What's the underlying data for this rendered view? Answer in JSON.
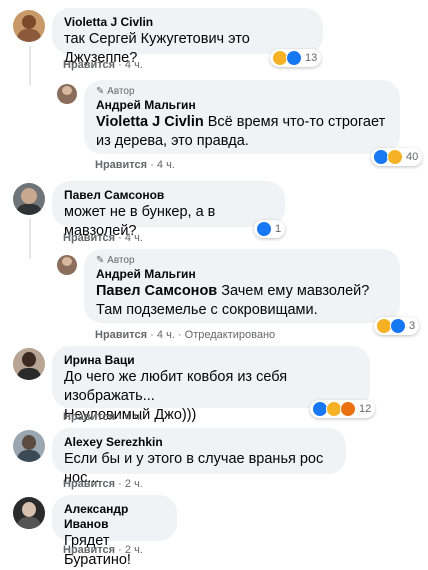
{
  "comments": [
    {
      "author": "Violetta J Civlin",
      "text": "так Сергей Кужугетович это Джузеппе?",
      "like": "Нравится",
      "time": "4 ч.",
      "reactions_count": "13"
    },
    {
      "badge": "Автор",
      "author": "Андрей Мальгин",
      "mention": "Violetta J Civlin",
      "text": "Всё время что-то строгает из дерева, это правда.",
      "like": "Нравится",
      "time": "4 ч.",
      "reactions_count": "40"
    },
    {
      "author": "Павел Самсонов",
      "text": "может не в бункер, а в мавзолей?",
      "like": "Нравится",
      "time": "4 ч.",
      "reactions_count": "1"
    },
    {
      "badge": "Автор",
      "author": "Андрей Мальгин",
      "mention": "Павел Самсонов",
      "text": "Зачем ему мавзолей? Там подземелье с сокровищами.",
      "like": "Нравится",
      "time": "4 ч.",
      "edited": "Отредактировано",
      "reactions_count": "3"
    },
    {
      "author": "Ирина Ваци",
      "text_line1": "До чего же любит ковбоя из себя изображать...",
      "text_line2": "Неуловимый Джо)))",
      "like": "Нравится",
      "time": "4 ч.",
      "reactions_count": "12"
    },
    {
      "author": "Alexey Serezhkin",
      "text": "Если бы и у этого в случае вранья рос нос...",
      "like": "Нравится",
      "time": "2 ч."
    },
    {
      "author": "Александр Иванов",
      "text": "Грядет Буратино!",
      "like": "Нравится",
      "time": "2 ч."
    }
  ],
  "separator": "·",
  "colors": {
    "like_blue": "#1877f2",
    "haha_yellow": "#f7b125",
    "angry_orange": "#e9710f",
    "love_red": "#f33e58",
    "bubble_gray": "#f0f2f5",
    "meta_gray": "#65676b"
  }
}
